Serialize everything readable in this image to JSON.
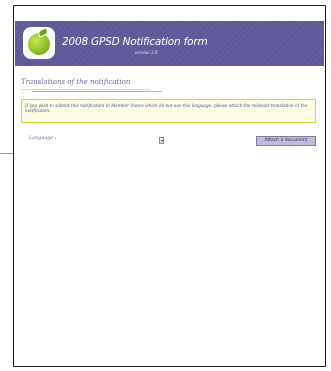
{
  "header": {
    "title": "2008 GPSD Notification form",
    "version": "version 1.0",
    "logo_icon": "apple-logo-icon",
    "banner_color": "#5e5a99"
  },
  "section": {
    "title": "Translations of the notification",
    "accent_color": "#b8cc1e"
  },
  "notice": {
    "text": "If you wish to submit this notification to Member States which do not use this language, please attach the relevant translation of the notification."
  },
  "language": {
    "label": "Language :",
    "selected": "",
    "dropdown_icon": "chevron-down-icon"
  },
  "actions": {
    "attach_label": "Attach a document"
  }
}
